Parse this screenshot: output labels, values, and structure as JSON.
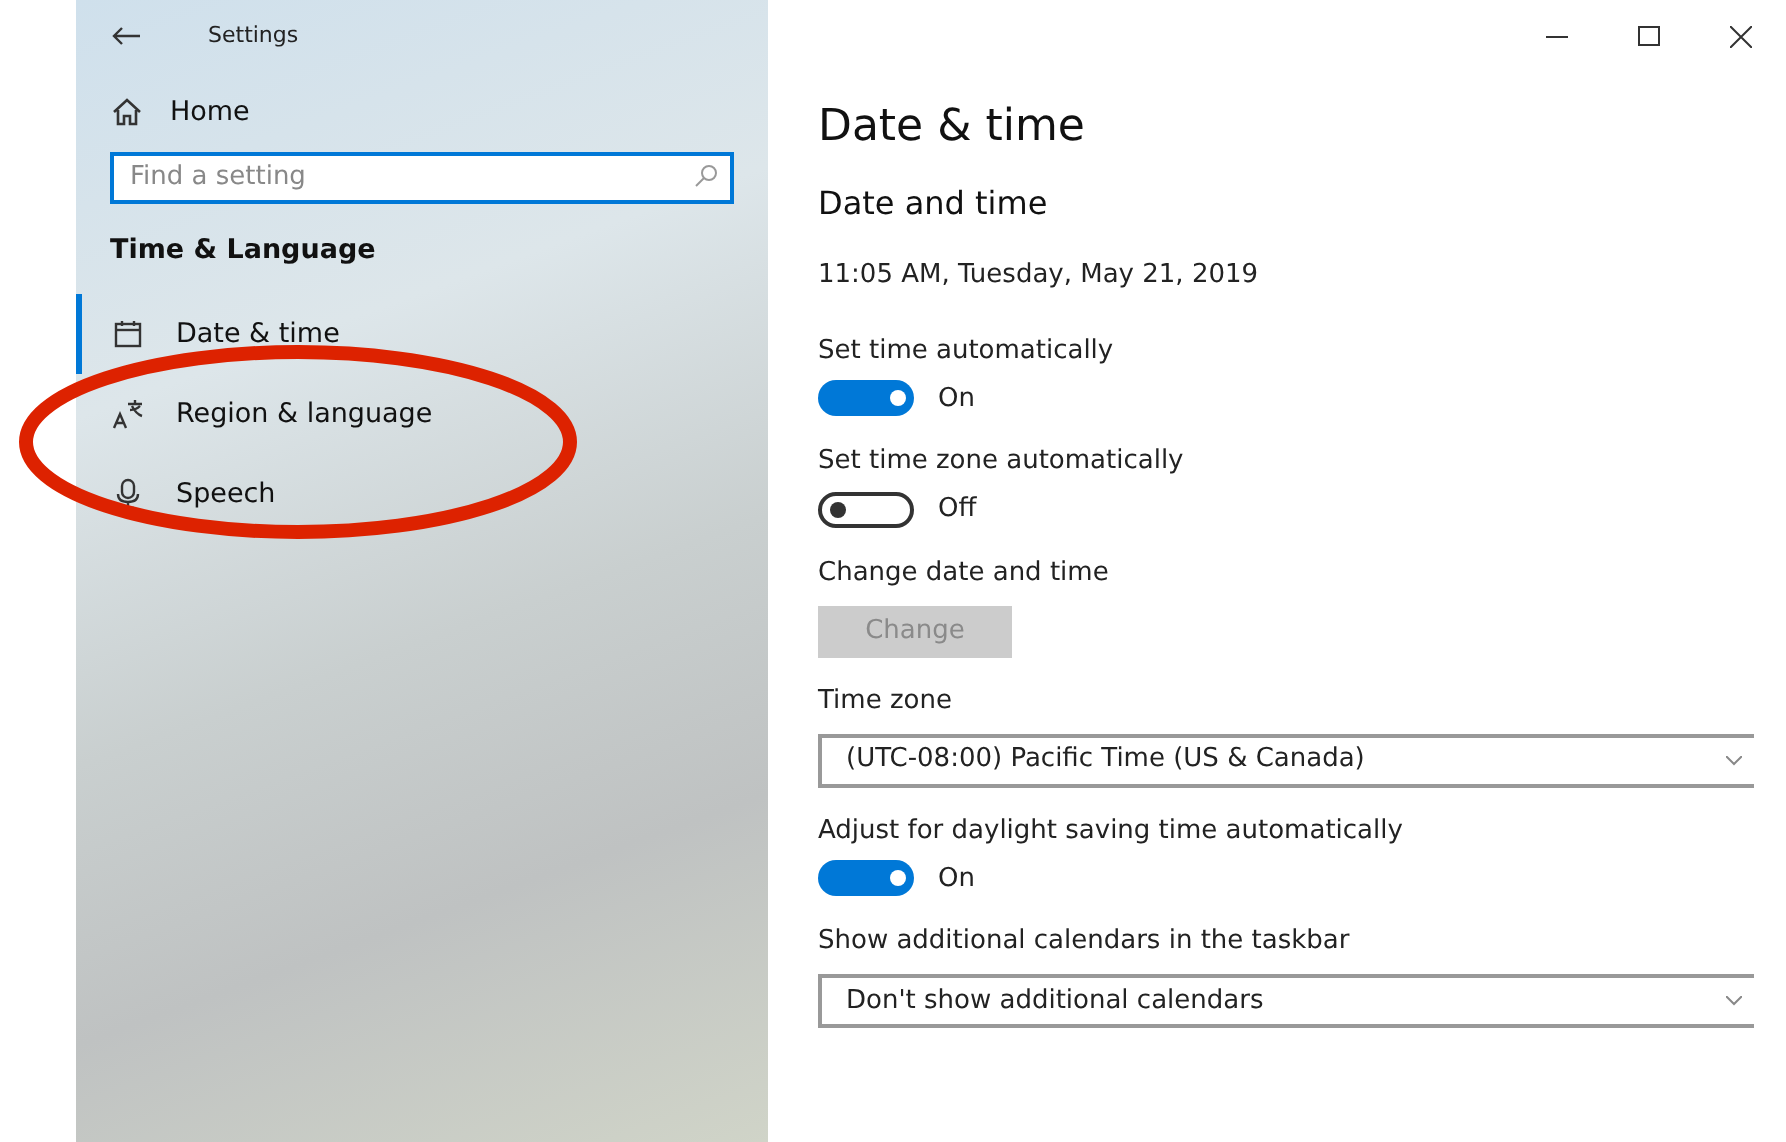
{
  "window": {
    "title": "Settings"
  },
  "sidebar": {
    "home": "Home",
    "search": {
      "placeholder": "Find a setting"
    },
    "section": "Time & Language",
    "items": [
      {
        "label": "Date & time",
        "selected": true
      },
      {
        "label": "Region & language",
        "selected": false
      },
      {
        "label": "Speech",
        "selected": false
      }
    ]
  },
  "page": {
    "title": "Date & time",
    "subtitle": "Date and time",
    "current": "11:05 AM, Tuesday, May 21, 2019",
    "settings": [
      {
        "kind": "toggle",
        "label": "Set time automatically",
        "on": true,
        "state": "On"
      },
      {
        "kind": "toggle",
        "label": "Set time zone automatically",
        "on": false,
        "state": "Off"
      },
      {
        "kind": "button",
        "label": "Change date and time",
        "button": "Change",
        "disabled": true
      },
      {
        "kind": "dropdown",
        "label": "Time zone",
        "value": "(UTC-08:00) Pacific Time (US & Canada)"
      },
      {
        "kind": "toggle",
        "label": "Adjust for daylight saving time automatically",
        "on": true,
        "state": "On"
      },
      {
        "kind": "dropdown",
        "label": "Show additional calendars in the taskbar",
        "value": "Don't show additional calendars"
      }
    ]
  }
}
